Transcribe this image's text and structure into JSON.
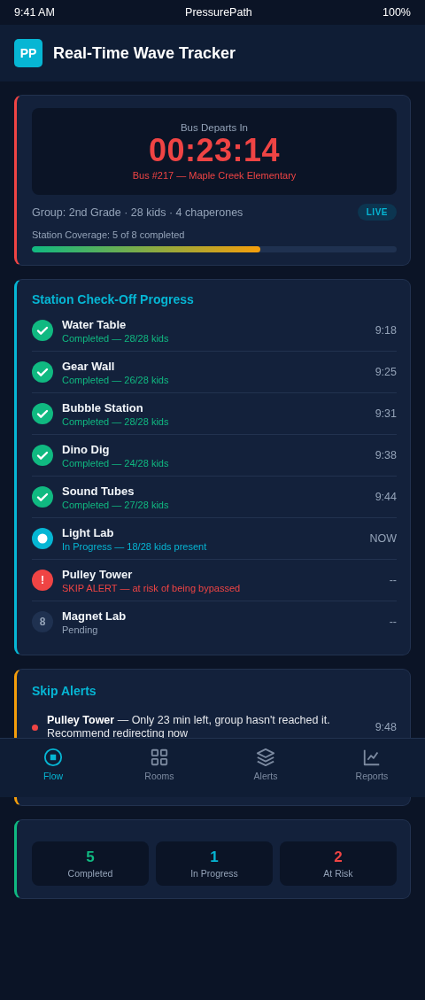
{
  "status_bar": {
    "time": "9:41 AM",
    "app_name": "PressurePath",
    "battery": "100%"
  },
  "header": {
    "logo": "PP",
    "title": "Real-Time Wave Tracker"
  },
  "departure": {
    "label": "Bus Departs In",
    "countdown": "00:23:14",
    "bus": "Bus #217 — Maple Creek Elementary",
    "group": "Group: 2nd Grade · 28 kids · 4 chaperones",
    "badge": "LIVE",
    "coverage_label": "Station Coverage: 5 of 8 completed",
    "coverage": {
      "level": 0.625
    }
  },
  "stations": {
    "title": "Station Check-Off Progress",
    "items": [
      {
        "name": "Water Table",
        "detail": "Completed — 28/28 kids",
        "time": "9:18",
        "kind": "done"
      },
      {
        "name": "Gear Wall",
        "detail": "Completed — 26/28 kids",
        "time": "9:25",
        "kind": "done"
      },
      {
        "name": "Bubble Station",
        "detail": "Completed — 28/28 kids",
        "time": "9:31",
        "kind": "done"
      },
      {
        "name": "Dino Dig",
        "detail": "Completed — 24/28 kids",
        "time": "9:38",
        "kind": "done"
      },
      {
        "name": "Sound Tubes",
        "detail": "Completed — 27/28 kids",
        "time": "9:44",
        "kind": "done"
      },
      {
        "name": "Light Lab",
        "detail": "In Progress — 18/28 kids present",
        "time": "NOW",
        "kind": "active"
      },
      {
        "name": "Pulley Tower",
        "detail": "SKIP ALERT — at risk of being bypassed",
        "time": "--",
        "kind": "alert",
        "badge": "!"
      },
      {
        "name": "Magnet Lab",
        "detail": "Pending",
        "time": "--",
        "kind": "pending",
        "badge": "8"
      }
    ]
  },
  "alerts": {
    "title": "Skip Alerts",
    "items": [
      {
        "text": "**Pulley Tower** — Only 23 min left, group hasn't reached it. Recommend redirecting now",
        "time": "9:48",
        "color": "#ef4444"
      }
    ]
  },
  "nav": {
    "items": [
      {
        "label": "Flow",
        "kind": "stop",
        "selected": true
      },
      {
        "label": "Rooms",
        "kind": "grid",
        "selected": false
      },
      {
        "label": "Alerts",
        "kind": "layers",
        "selected": false
      },
      {
        "label": "Reports",
        "kind": "chart",
        "selected": false
      }
    ]
  },
  "summary": {
    "stats": [
      {
        "value": "5",
        "label": "Completed",
        "kind": "done"
      },
      {
        "value": "1",
        "label": "In Progress",
        "kind": "active"
      },
      {
        "value": "2",
        "label": "At Risk",
        "kind": "risk"
      }
    ]
  }
}
